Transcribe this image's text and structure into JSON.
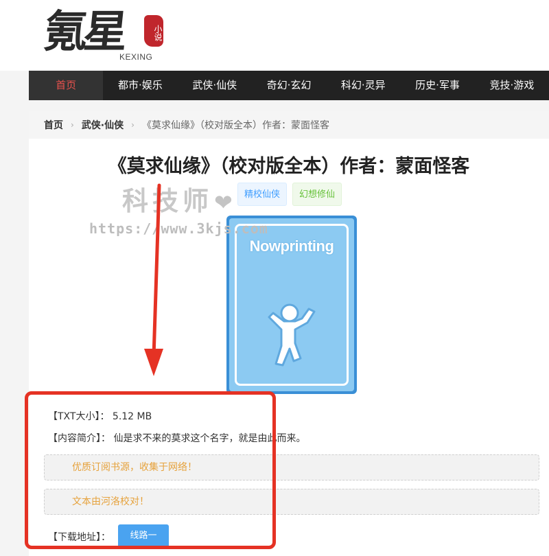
{
  "logo": {
    "main": "氪星",
    "seal": "小说",
    "sub": "KEXING"
  },
  "nav": {
    "items": [
      {
        "label": "首页",
        "active": true
      },
      {
        "label": "都市·娱乐"
      },
      {
        "label": "武侠·仙侠"
      },
      {
        "label": "奇幻·玄幻"
      },
      {
        "label": "科幻·灵异"
      },
      {
        "label": "历史·军事"
      },
      {
        "label": "竞技·游戏"
      }
    ]
  },
  "breadcrumb": {
    "home": "首页",
    "category": "武侠·仙侠",
    "current": "《莫求仙缘》（校对版全本）作者：蒙面怪客",
    "separator": "›"
  },
  "book": {
    "title": "《莫求仙缘》（校对版全本）作者：蒙面怪客",
    "tags": [
      "精校仙侠",
      "幻想修仙"
    ],
    "cover_text": "Nowprinting",
    "size_label": "【TXT大小】：",
    "size_value": "5.12 MB",
    "intro_label": "【内容简介】：",
    "intro_value": "仙是求不来的莫求这个名字，就是由此而来。",
    "notices": [
      "优质订阅书源，收集于网络！",
      "文本由河洛校对！"
    ],
    "download_label": "【下载地址】：",
    "download_button": "线路一"
  },
  "watermark": {
    "line1": "科技师",
    "line2": "https://www.3kjs.com",
    "heart": "❤"
  },
  "colors": {
    "nav_bg": "#222222",
    "nav_active_text": "#e8524d",
    "annotation_red": "#e53224",
    "button_blue": "#4aa3f0",
    "notice_text": "#e6a23c"
  }
}
